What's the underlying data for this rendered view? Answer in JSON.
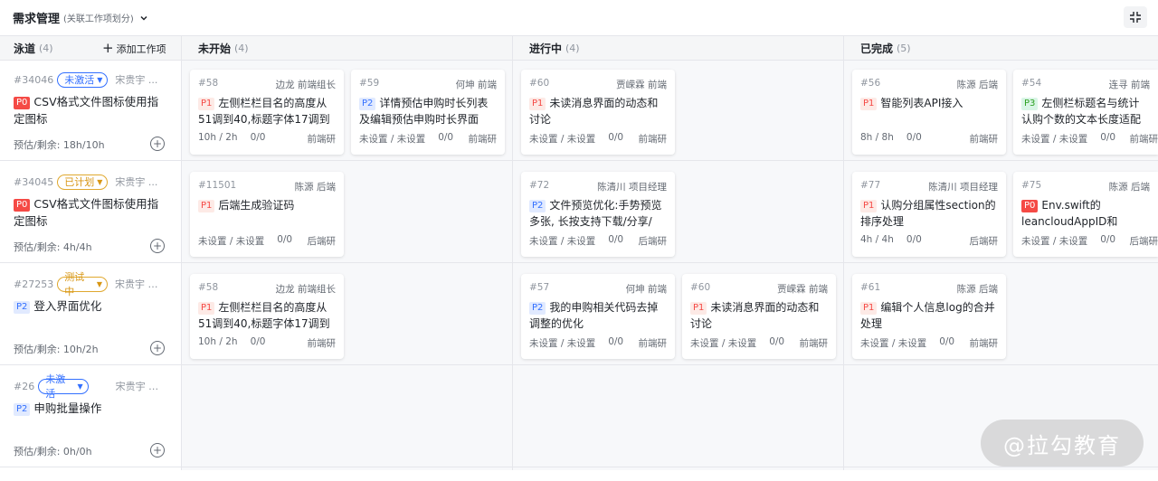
{
  "header": {
    "title": "需求管理",
    "subtitle": "(关联工作项划分)"
  },
  "columns": {
    "lane": {
      "label": "泳道",
      "count": "(4)",
      "add_label": "添加工作项"
    },
    "not_started": {
      "label": "未开始",
      "count": "(4)"
    },
    "in_progress": {
      "label": "进行中",
      "count": "(4)"
    },
    "done": {
      "label": "已完成",
      "count": "(5)"
    }
  },
  "lanes": [
    {
      "id": "#34046",
      "status": "未激活",
      "owner": "宋贵宇 ...",
      "priority": "P0",
      "title": "CSV格式文件图标使用指定图标",
      "estimate": "预估/剩余: 18h/10h"
    },
    {
      "id": "#34045",
      "status": "已计划",
      "owner": "宋贵宇 ...",
      "priority": "P0",
      "title": "CSV格式文件图标使用指定图标",
      "estimate": "预估/剩余: 4h/4h"
    },
    {
      "id": "#27253",
      "status": "测试中",
      "owner": "宋贵宇 产品",
      "priority": "P2",
      "title": "登入界面优化",
      "estimate": "预估/剩余: 10h/2h"
    },
    {
      "id": "#26",
      "status": "未激活",
      "owner": "宋贵宇 产品",
      "priority": "P2",
      "title": "申购批量操作",
      "estimate": "预估/剩余: 0h/0h"
    }
  ],
  "cards": [
    {
      "id": "#58",
      "who": "边龙 前端组长",
      "priority": "P1",
      "title": "左侧栏栏目名的高度从51调到40,标题字体17调到1",
      "time": "10h / 2h",
      "ratio": "0/0",
      "group": "前端研"
    },
    {
      "id": "#59",
      "who": "何坤 前端",
      "priority": "P2",
      "title": "详情预估申购时长列表及编辑预估申购时长界面",
      "time": "未设置 / 未设置",
      "ratio": "0/0",
      "group": "前端研"
    },
    {
      "id": "#60",
      "who": "贾嵘霖 前端",
      "priority": "P1",
      "title": "未读消息界面的动态和讨论",
      "time": "未设置 / 未设置",
      "ratio": "0/0",
      "group": "前端研"
    },
    {
      "id": "#56",
      "who": "陈源 后端",
      "priority": "P1",
      "title": "智能列表API接入",
      "time": "8h / 8h",
      "ratio": "0/0",
      "group": "前端研"
    },
    {
      "id": "#54",
      "who": "连寻 前端",
      "priority": "P3",
      "title": "左侧栏标题名与统计认购个数的文本长度适配",
      "time": "未设置 / 未设置",
      "ratio": "0/0",
      "group": "前端研"
    },
    {
      "id": "#11501",
      "who": "陈源 后端",
      "priority": "P1",
      "title": "后端生成验证码",
      "time": "未设置 / 未设置",
      "ratio": "0/0",
      "group": "后端研"
    },
    {
      "id": "#72",
      "who": "陈清川 项目经理",
      "priority": "P2",
      "title": "文件预览优化:手势预览多张, 长按支持下载/分享/",
      "time": "未设置 / 未设置",
      "ratio": "0/0",
      "group": "后端研"
    },
    {
      "id": "#77",
      "who": "陈清川 项目经理",
      "priority": "P1",
      "title": "认购分组属性section的排序处理",
      "time": "4h / 4h",
      "ratio": "0/0",
      "group": "后端研"
    },
    {
      "id": "#75",
      "who": "陈源 后端",
      "priority": "P0",
      "title": "Env.swift的leancloudAppID和leancloudAppKey改",
      "time": "未设置 / 未设置",
      "ratio": "0/0",
      "group": "后端研"
    },
    {
      "id": "#58",
      "who": "边龙 前端组长",
      "priority": "P1",
      "title": "左侧栏栏目名的高度从51调到40,标题字体17调到1",
      "time": "10h / 2h",
      "ratio": "0/0",
      "group": "前端研"
    },
    {
      "id": "#57",
      "who": "何坤 前端",
      "priority": "P2",
      "title": "我的申购相关代码去掉调整的优化",
      "time": "未设置 / 未设置",
      "ratio": "0/0",
      "group": "前端研"
    },
    {
      "id": "#60",
      "who": "贾嵘霖 前端",
      "priority": "P1",
      "title": "未读消息界面的动态和讨论",
      "time": "未设置 / 未设置",
      "ratio": "0/0",
      "group": "前端研"
    },
    {
      "id": "#61",
      "who": "陈源 后端",
      "priority": "P1",
      "title": "编辑个人信息log的合并处理",
      "time": "未设置 / 未设置",
      "ratio": "0/0",
      "group": "前端研"
    }
  ],
  "watermark": "@拉勾教育",
  "colors": {
    "accent": "#3370ff",
    "p0": "#f54a45",
    "p1": "#f54a45",
    "p2": "#3370ff",
    "p3": "#2ea121",
    "warn": "#d89614"
  }
}
